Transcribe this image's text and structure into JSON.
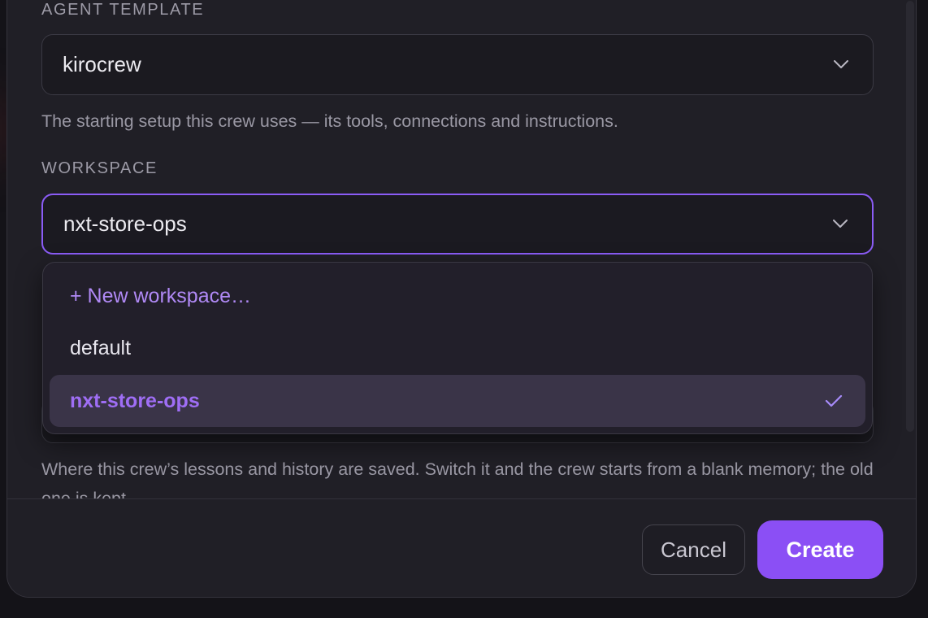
{
  "form": {
    "agent_template": {
      "label": "AGENT TEMPLATE",
      "value": "kirocrew",
      "help": "The starting setup this crew uses — its tools, connections and instructions."
    },
    "workspace": {
      "label": "WORKSPACE",
      "value": "nxt-store-ops",
      "help": "Where this crew’s lessons and history are saved. Switch it and the crew starts from a blank memory; the old one is kept."
    }
  },
  "workspace_menu": {
    "options": [
      {
        "label": "+ New workspace…",
        "kind": "new"
      },
      {
        "label": "default",
        "kind": "option"
      },
      {
        "label": "nxt-store-ops",
        "kind": "option",
        "selected": true
      }
    ]
  },
  "footer": {
    "cancel_label": "Cancel",
    "create_label": "Create"
  },
  "colors": {
    "accent": "#8b5cf6",
    "create_button": "#8b4ff5",
    "dialog_bg": "#201f26"
  },
  "icons": {
    "select_chevron": "chevron-down-icon",
    "selected_mark": "check-icon"
  }
}
